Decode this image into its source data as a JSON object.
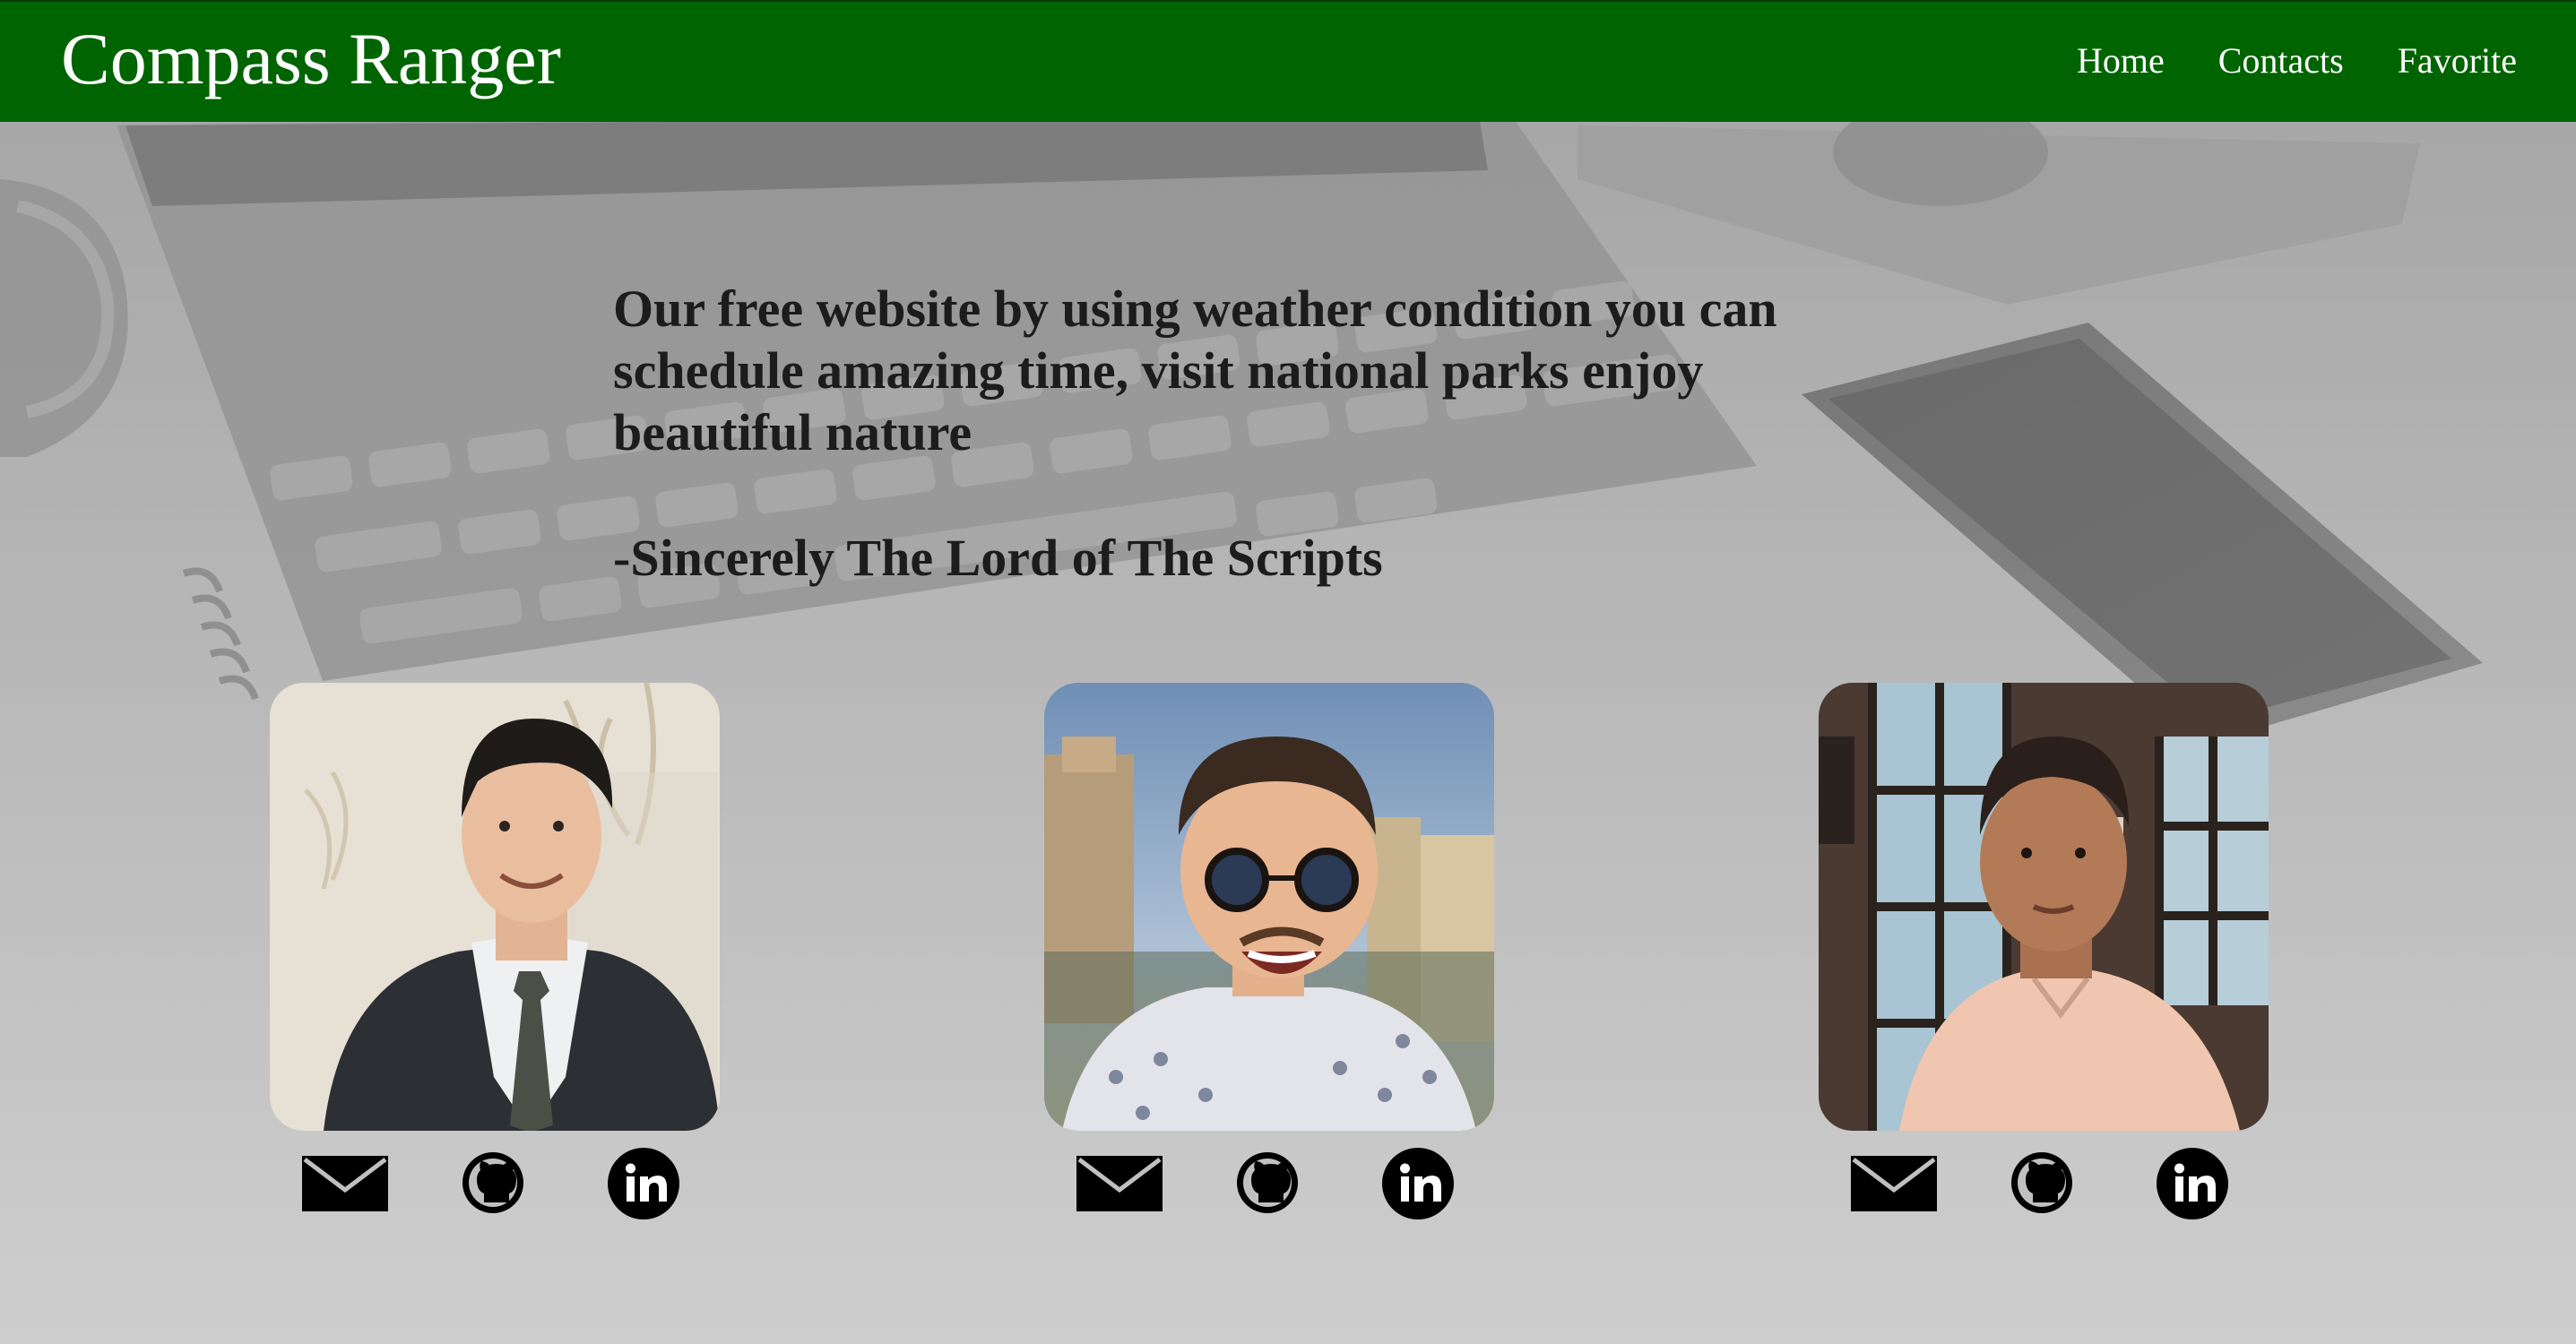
{
  "header": {
    "brand": "Compass Ranger",
    "nav": [
      "Home",
      "Contacts",
      "Favorite"
    ]
  },
  "intro": {
    "text": "Our free website by using weather condition you can schedule amazing time, visit national parks enjoy beautiful nature",
    "signature": "-Sincerely The Lord of The Scripts"
  },
  "team": [
    {
      "icons": [
        "mail-icon",
        "github-icon",
        "linkedin-icon"
      ]
    },
    {
      "icons": [
        "mail-icon",
        "github-icon",
        "linkedin-icon"
      ]
    },
    {
      "icons": [
        "mail-icon",
        "github-icon",
        "linkedin-icon"
      ]
    }
  ],
  "colors": {
    "header": "#006400",
    "header_text": "#ffffff",
    "body_text": "#1c1c1c",
    "icon": "#000000"
  }
}
